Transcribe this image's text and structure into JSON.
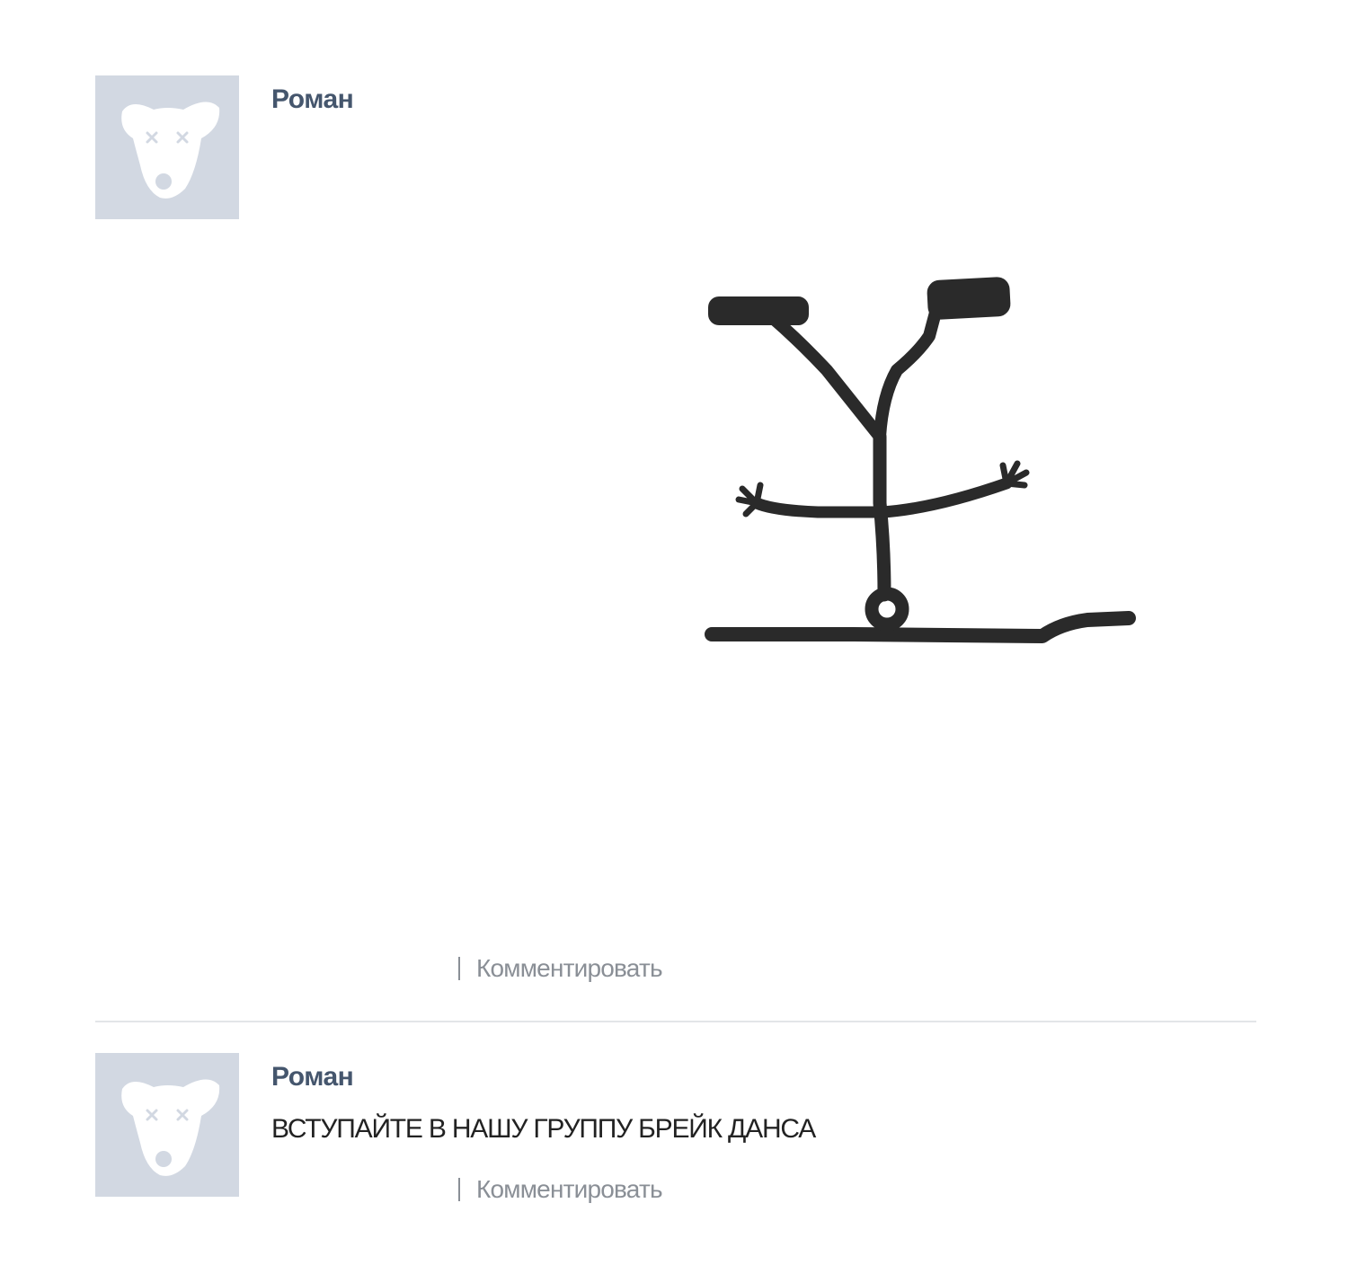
{
  "posts": [
    {
      "author": "Роман",
      "text": "",
      "has_drawing": true,
      "comment_label": "Комментировать"
    },
    {
      "author": "Роман",
      "text": "ВСТУПАЙТЕ В НАШУ ГРУППУ БРЕЙК ДАНСА",
      "has_drawing": false,
      "comment_label": "Комментировать"
    }
  ],
  "colors": {
    "avatar_bg": "#d2d8e2",
    "author_link": "#45566d",
    "footer_text": "#8a8f96",
    "divider": "#e3e5e8",
    "drawing_stroke": "#2a2a2a"
  },
  "icons": {
    "avatar": "default-dog-avatar-icon"
  }
}
